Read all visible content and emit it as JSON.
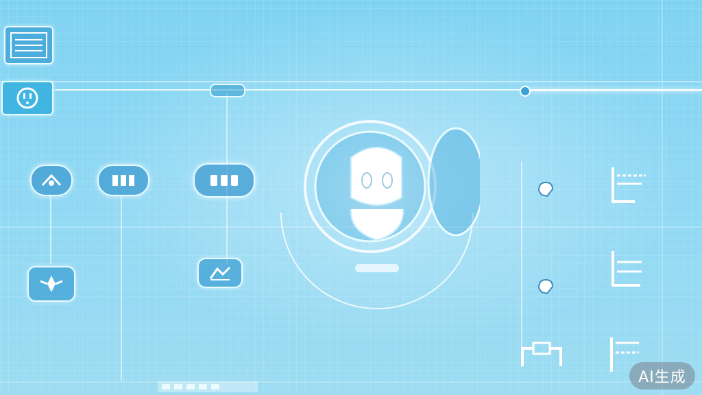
{
  "badge": {
    "label": "AI生成"
  },
  "colors": {
    "background": "#8fd8f4",
    "glow": "#ffffff",
    "accent": "#2a8cc8"
  },
  "icons": {
    "top_left_panel": "menu-list-icon",
    "top_left_socket": "power-socket-icon",
    "bubble_1": "chat-bubble-icon",
    "bubble_2": "chat-bubble-icon",
    "bubble_3": "chat-bubble-icon",
    "lower_left": "star-person-icon",
    "lower_mid": "chart-icon",
    "center": "robot-avatar-icon",
    "right_1": "hand-icon",
    "right_2": "hand-icon",
    "right_panels": "bracket-panel-icon"
  }
}
